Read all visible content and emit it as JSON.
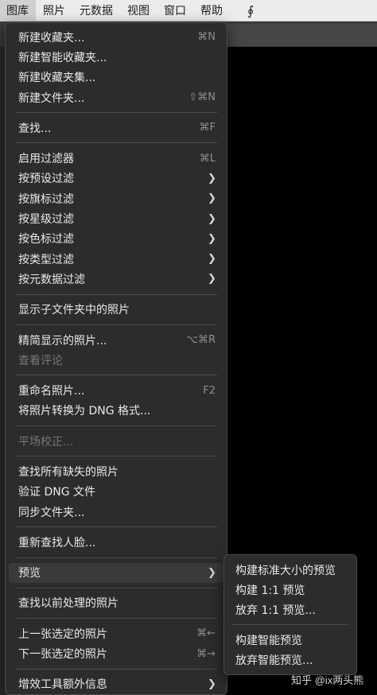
{
  "menubar": {
    "items": [
      {
        "label": "图库",
        "active": true
      },
      {
        "label": "照片"
      },
      {
        "label": "元数据"
      },
      {
        "label": "视图"
      },
      {
        "label": "窗口"
      },
      {
        "label": "帮助"
      }
    ],
    "app_icon": "lightroom-script-icon"
  },
  "menu": {
    "items": [
      {
        "label": "新建收藏夹...",
        "shortcut": "⌘N"
      },
      {
        "label": "新建智能收藏夹..."
      },
      {
        "label": "新建收藏夹集..."
      },
      {
        "label": "新建文件夹...",
        "shortcut": "⇧⌘N"
      },
      {
        "label": "查找...",
        "shortcut": "⌘F"
      },
      {
        "label": "启用过滤器",
        "shortcut": "⌘L"
      },
      {
        "label": "按预设过滤"
      },
      {
        "label": "按旗标过滤"
      },
      {
        "label": "按星级过滤"
      },
      {
        "label": "按色标过滤"
      },
      {
        "label": "按类型过滤"
      },
      {
        "label": "按元数据过滤"
      },
      {
        "label": "显示子文件夹中的照片"
      },
      {
        "label": "精简显示的照片...",
        "shortcut": "⌥⌘R"
      },
      {
        "label": "查看评论",
        "disabled": true
      },
      {
        "label": "重命名照片...",
        "shortcut": "F2"
      },
      {
        "label": "将照片转换为 DNG 格式..."
      },
      {
        "label": "平场校正...",
        "disabled": true
      },
      {
        "label": "查找所有缺失的照片"
      },
      {
        "label": "验证 DNG 文件"
      },
      {
        "label": "同步文件夹..."
      },
      {
        "label": "重新查找人脸..."
      },
      {
        "label": "预览",
        "highlighted": true
      },
      {
        "label": "查找以前处理的照片"
      },
      {
        "label": "上一张选定的照片",
        "shortcut": "⌘←"
      },
      {
        "label": "下一张选定的照片",
        "shortcut": "⌘→"
      },
      {
        "label": "增效工具额外信息"
      }
    ]
  },
  "submenu": {
    "items": [
      {
        "label": "构建标准大小的预览"
      },
      {
        "label": "构建 1:1 预览"
      },
      {
        "label": "放弃 1:1 预览..."
      },
      {
        "label": "构建智能预览"
      },
      {
        "label": "放弃智能预览..."
      }
    ]
  },
  "watermark": "知乎 @ix两头熊"
}
